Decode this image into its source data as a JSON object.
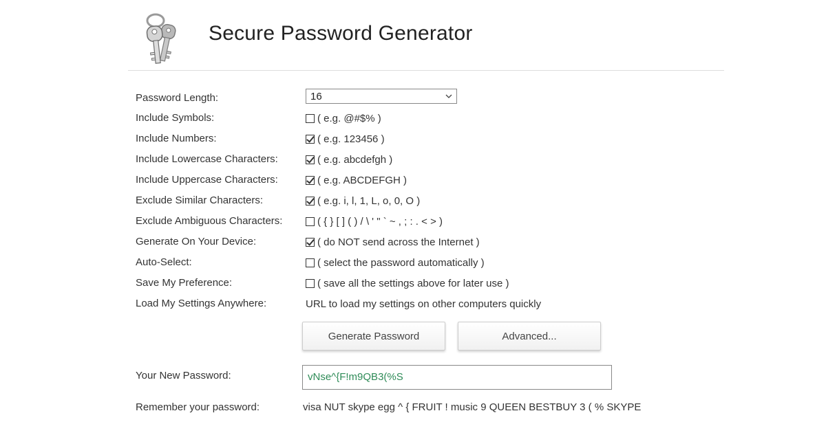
{
  "header": {
    "title": "Secure Password Generator",
    "logo_icon": "keys-icon"
  },
  "form": {
    "length": {
      "label": "Password Length:",
      "value": "16"
    },
    "symbols": {
      "label": "Include Symbols:",
      "hint": "( e.g. @#$% )",
      "checked": false
    },
    "numbers": {
      "label": "Include Numbers:",
      "hint": "( e.g. 123456 )",
      "checked": true
    },
    "lowercase": {
      "label": "Include Lowercase Characters:",
      "hint": "( e.g. abcdefgh )",
      "checked": true
    },
    "uppercase": {
      "label": "Include Uppercase Characters:",
      "hint": "( e.g. ABCDEFGH )",
      "checked": true
    },
    "similar": {
      "label": "Exclude Similar Characters:",
      "hint": "( e.g. i, l, 1, L, o, 0, O )",
      "checked": true
    },
    "ambiguous": {
      "label": "Exclude Ambiguous Characters:",
      "hint": "( { } [ ] ( ) / \\ ' \" ` ~ , ; : . < > )",
      "checked": false
    },
    "device": {
      "label": "Generate On Your Device:",
      "hint": "( do NOT send across the Internet )",
      "checked": true
    },
    "autoselect": {
      "label": "Auto-Select:",
      "hint": "( select the password automatically )",
      "checked": false
    },
    "preference": {
      "label": "Save My Preference:",
      "hint": "( save all the settings above for later use )",
      "checked": false
    },
    "load": {
      "label": "Load My Settings Anywhere:",
      "value": "URL to load my settings on other computers quickly"
    }
  },
  "buttons": {
    "generate": "Generate Password",
    "advanced": "Advanced..."
  },
  "output": {
    "password_label": "Your New Password:",
    "password_value": "vNse^{F!m9QB3(%S",
    "remember_label": "Remember your password:",
    "remember_value": "visa NUT skype egg ^ { FRUIT ! music 9 QUEEN BESTBUY 3 ( % SKYPE"
  },
  "colors": {
    "password_text": "#2e8b57",
    "divider": "#dddddd"
  }
}
